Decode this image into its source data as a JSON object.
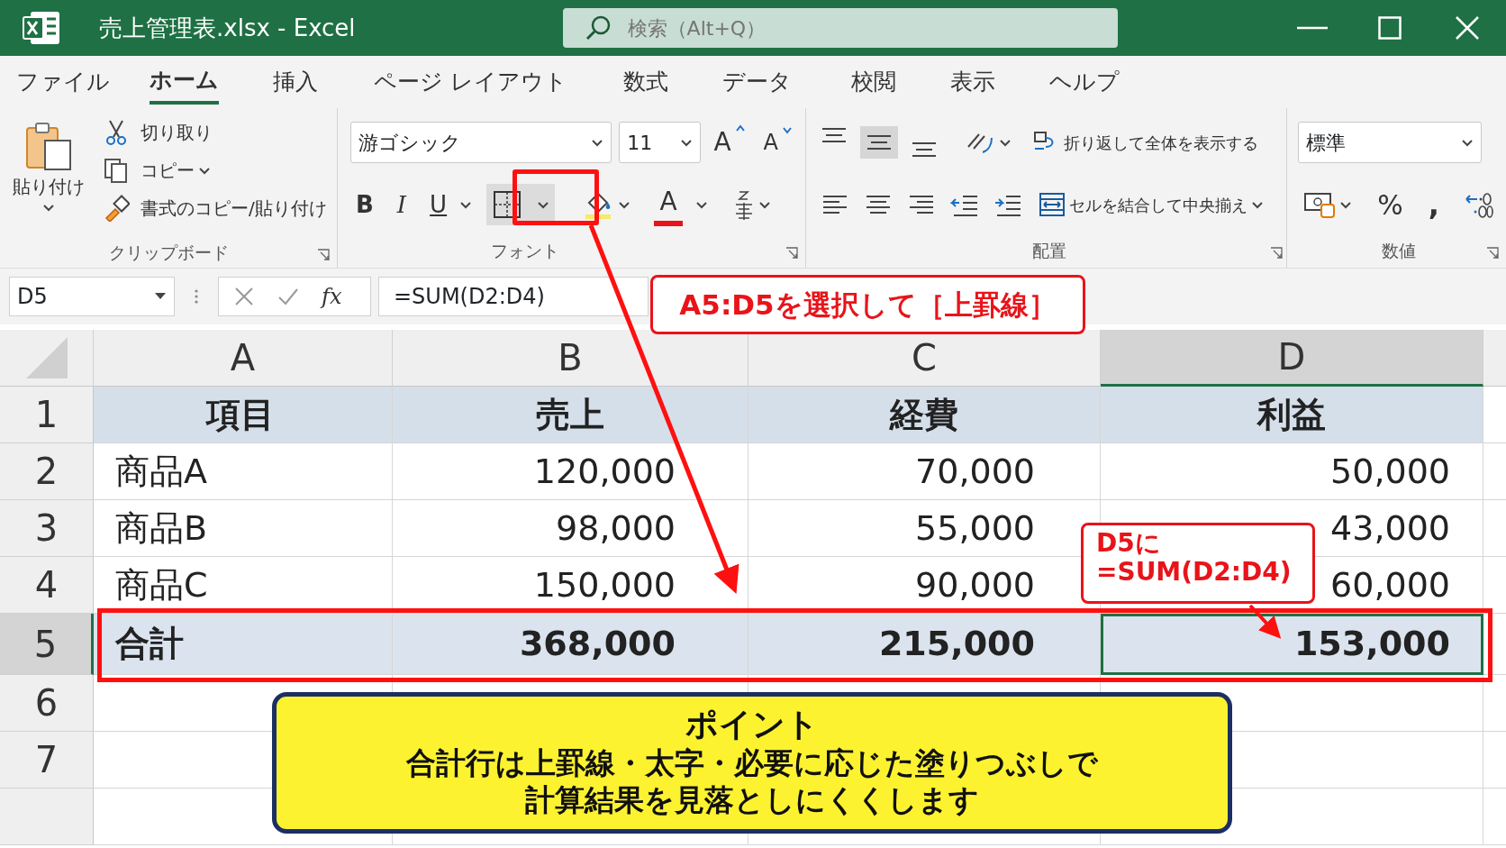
{
  "window": {
    "title": "売上管理表.xlsx - Excel"
  },
  "search": {
    "placeholder": "検索（Alt+Q）"
  },
  "tabs": [
    {
      "label": "ファイル",
      "selected": false
    },
    {
      "label": "ホーム",
      "selected": true
    },
    {
      "label": "挿入",
      "selected": false
    },
    {
      "label": "ページ レイアウト",
      "selected": false
    },
    {
      "label": "数式",
      "selected": false
    },
    {
      "label": "データ",
      "selected": false
    },
    {
      "label": "校閲",
      "selected": false
    },
    {
      "label": "表示",
      "selected": false
    },
    {
      "label": "ヘルプ",
      "selected": false
    }
  ],
  "ribbon": {
    "clipboard": {
      "paste": "貼り付け",
      "cut": "切り取り",
      "copy": "コピー",
      "format_painter": "書式のコピー/貼り付け",
      "label": "クリップボード"
    },
    "font": {
      "font_name": "游ゴシック",
      "font_size": "11",
      "grow": "A",
      "shrink": "A",
      "bold": "B",
      "italic": "I",
      "underline": "U",
      "font_color": "A",
      "label": "フォント"
    },
    "alignment": {
      "vertical": [
        {
          "kind": "top",
          "selected": false
        },
        {
          "kind": "middle",
          "selected": true
        },
        {
          "kind": "bottom",
          "selected": false
        }
      ],
      "horizontal": [
        {
          "kind": "left",
          "selected": false
        },
        {
          "kind": "center",
          "selected": false
        },
        {
          "kind": "right",
          "selected": false
        }
      ],
      "wrap_text": "折り返して全体を表示する",
      "merge": "セルを結合して中央揃え",
      "label": "配置"
    },
    "number": {
      "format": "標準",
      "percent": "%",
      "comma": ",",
      "label": "数値"
    }
  },
  "formula_bar": {
    "name_box": "D5",
    "fx": "fx",
    "formula": "=SUM(D2:D4)"
  },
  "sheet": {
    "columns": [
      {
        "label": "A",
        "selected": false
      },
      {
        "label": "B",
        "selected": false
      },
      {
        "label": "C",
        "selected": false
      },
      {
        "label": "D",
        "selected": true
      }
    ],
    "rows": [
      {
        "number": "1",
        "kind": "header",
        "selected": false,
        "cells": [
          "項目",
          "売上",
          "経費",
          "利益"
        ]
      },
      {
        "number": "2",
        "kind": "data",
        "selected": false,
        "cells": [
          "商品A",
          "120,000",
          "70,000",
          "50,000"
        ]
      },
      {
        "number": "3",
        "kind": "data",
        "selected": false,
        "cells": [
          "商品B",
          "98,000",
          "55,000",
          "43,000"
        ]
      },
      {
        "number": "4",
        "kind": "data",
        "selected": false,
        "cells": [
          "商品C",
          "150,000",
          "90,000",
          "60,000"
        ]
      },
      {
        "number": "5",
        "kind": "total",
        "selected": true,
        "cells": [
          "合計",
          "368,000",
          "215,000",
          "153,000"
        ]
      },
      {
        "number": "6",
        "kind": "empty",
        "selected": false
      },
      {
        "number": "7",
        "kind": "empty",
        "selected": false
      }
    ]
  },
  "annotations": {
    "instruction": "A5:D5を選択して［上罫線］",
    "formula_note": [
      "D5に",
      "=SUM(D2:D4)"
    ],
    "point": {
      "title": "ポイント",
      "lines": [
        "合計行は上罫線・太字・必要に応じた塗りつぶしで",
        "計算結果を見落としにくくします"
      ]
    }
  }
}
